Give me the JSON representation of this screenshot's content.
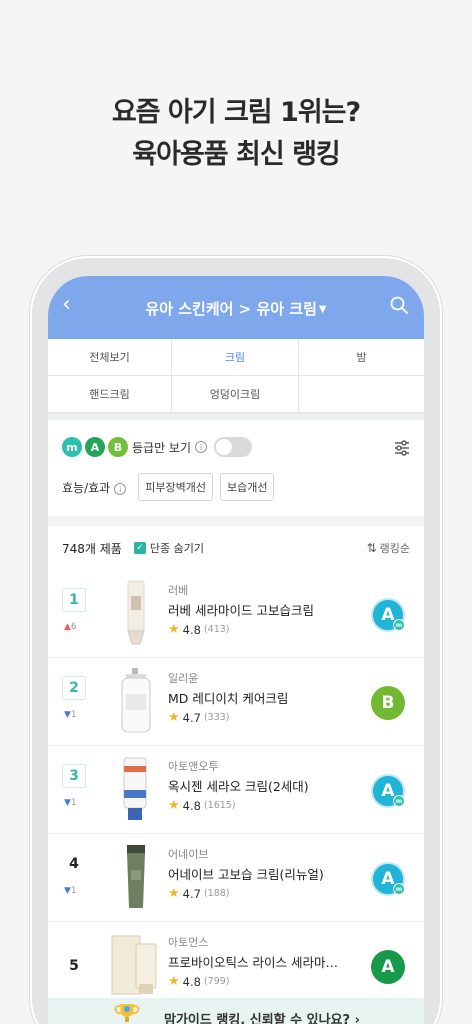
{
  "headline": {
    "line1": "요즘 아기 크림 1위는?",
    "line2": "육아용품 최신 랭킹"
  },
  "appbar": {
    "title": "유아 스킨케어 > 유아 크림",
    "caret": "▼",
    "back_icon": "chevron-left-icon",
    "search_icon": "search-icon"
  },
  "tabs": [
    {
      "label": "전체보기"
    },
    {
      "label": "크림",
      "active": true
    },
    {
      "label": "밤"
    },
    {
      "label": "핸드크림"
    },
    {
      "label": "엉덩이크림"
    },
    {
      "label": ""
    }
  ],
  "filters": {
    "grade_badges": [
      "m",
      "A",
      "B"
    ],
    "grade_label": "등급만 보기",
    "effect_label": "효능/효과",
    "chips": [
      "피부장벽개선",
      "보습개선"
    ]
  },
  "list_header": {
    "count": "748개 제품",
    "hide_discontinued": "단종 숨기기",
    "sort": "랭킹순"
  },
  "products": [
    {
      "rank": "1",
      "delta": "6",
      "dir": "up",
      "brand": "러베",
      "name": "러베 세라마이드 고보습크림",
      "rating": "4.8",
      "reviews": "(413)",
      "grade": "A",
      "grade_style": "ac"
    },
    {
      "rank": "2",
      "delta": "1",
      "dir": "down",
      "brand": "일리윤",
      "name": "MD 레디이치 케어크림",
      "rating": "4.7",
      "reviews": "(333)",
      "grade": "B",
      "grade_style": "bg"
    },
    {
      "rank": "3",
      "delta": "1",
      "dir": "down",
      "brand": "아토앤오투",
      "name": "옥시젠 세라오 크림(2세대)",
      "rating": "4.8",
      "reviews": "(1615)",
      "grade": "A",
      "grade_style": "ac"
    },
    {
      "rank": "4",
      "delta": "1",
      "dir": "down",
      "brand": "어네이브",
      "name": "어네이브 고보습 크림(리뉴얼)",
      "rating": "4.7",
      "reviews": "(188)",
      "grade": "A",
      "grade_style": "ac"
    },
    {
      "rank": "5",
      "delta": "",
      "dir": "",
      "brand": "아토먼스",
      "name": "프로바이오틱스 라이스 세라마…",
      "rating": "4.8",
      "reviews": "(799)",
      "grade": "A",
      "grade_style": "ag"
    }
  ],
  "banner": {
    "text": "맘가이드 랭킹, 신뢰할 수 있나요? ›"
  }
}
